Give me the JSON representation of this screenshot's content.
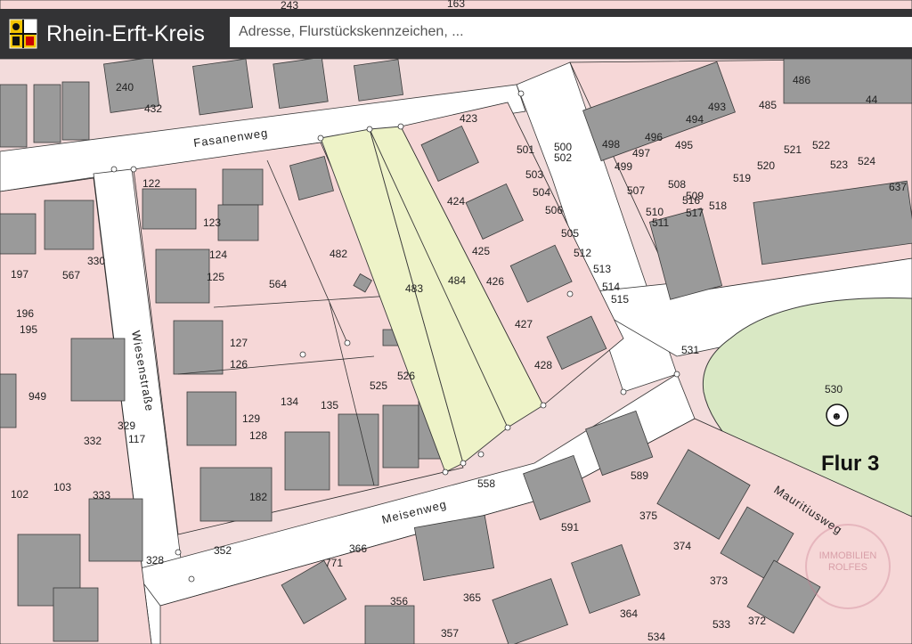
{
  "header": {
    "title": "Rhein-Erft-Kreis",
    "search_placeholder": "Adresse, Flurstückskennzeichen, ..."
  },
  "streets": {
    "fasanenweg": "Fasanenweg",
    "wiesenstrasse": "Wiesenstraße",
    "meisenweg": "Meisenweg",
    "mauritiusweg": "Mauritiusweg"
  },
  "flur": "Flur 3",
  "parcels": [
    "243",
    "163",
    "240",
    "432",
    "122",
    "123",
    "124",
    "125",
    "127",
    "126",
    "129",
    "128",
    "182",
    "134",
    "135",
    "525",
    "526",
    "482",
    "564",
    "483",
    "484",
    "423",
    "424",
    "425",
    "426",
    "427",
    "428",
    "501",
    "500",
    "502",
    "503",
    "504",
    "505",
    "506",
    "507",
    "508",
    "509",
    "510",
    "511",
    "512",
    "513",
    "514",
    "515",
    "516",
    "517",
    "518",
    "519",
    "520",
    "521",
    "522",
    "523",
    "524",
    "637",
    "486",
    "44",
    "485",
    "493",
    "494",
    "495",
    "496",
    "497",
    "498",
    "499",
    "531",
    "530",
    "558",
    "589",
    "591",
    "375",
    "374",
    "373",
    "372",
    "364",
    "365",
    "356",
    "357",
    "366",
    "771",
    "352",
    "328",
    "333",
    "103",
    "102",
    "332",
    "117",
    "329",
    "949",
    "195",
    "196",
    "197",
    "567",
    "330",
    "533",
    "534"
  ],
  "watermark": "IMMOBILIEN ROLFES"
}
